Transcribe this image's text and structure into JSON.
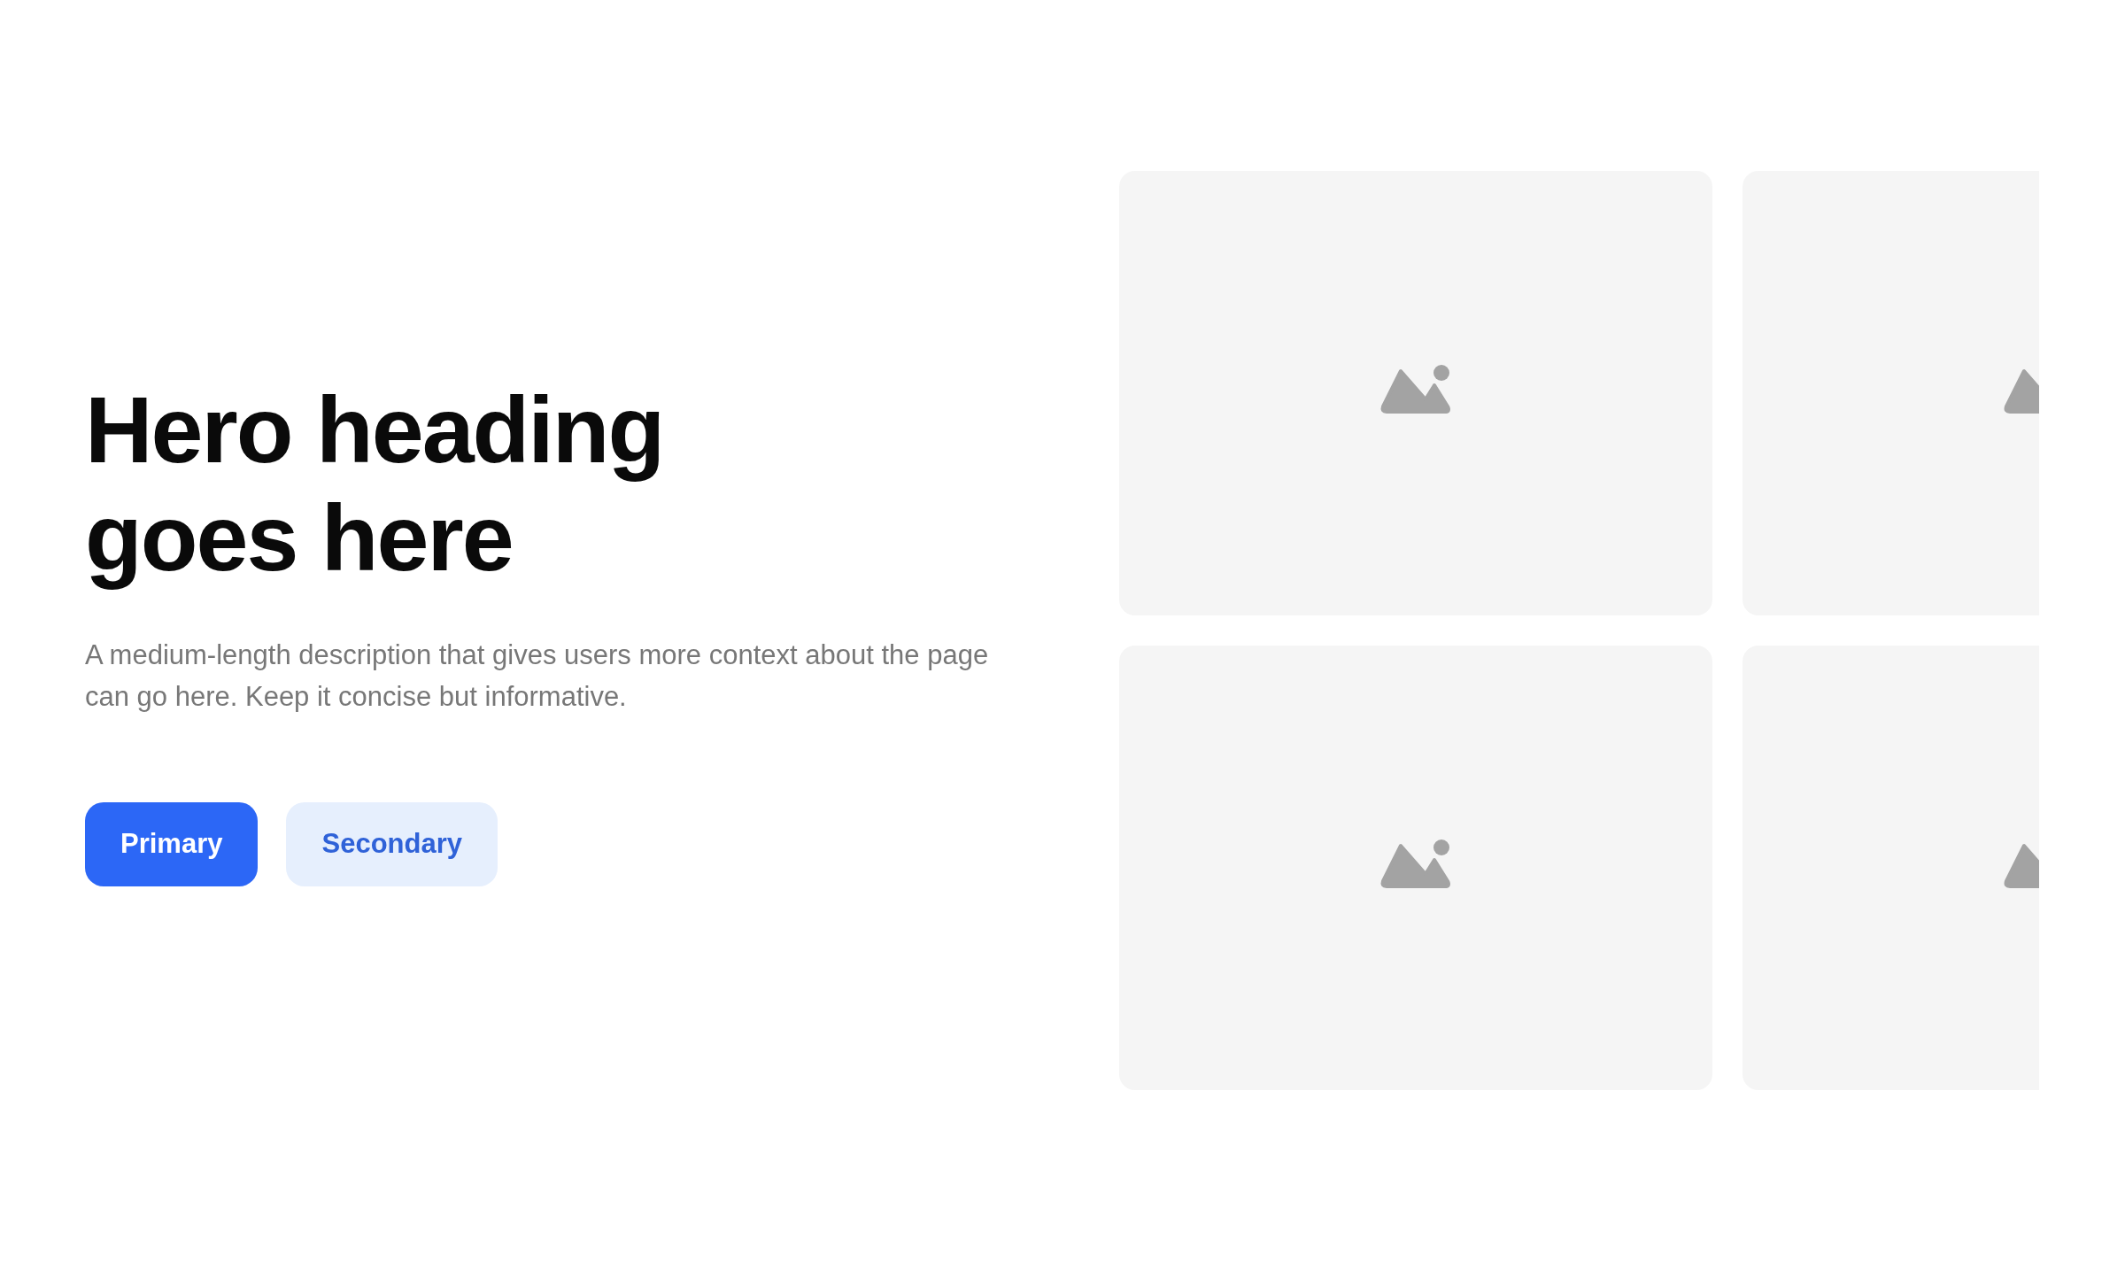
{
  "hero": {
    "heading": "Hero heading goes here",
    "description": "A medium-length description that gives users more context about the page can go here. Keep it concise but informative.",
    "buttons": [
      {
        "label": "Primary",
        "kind": "primary"
      },
      {
        "label": "Secondary",
        "kind": "secondary"
      }
    ]
  }
}
